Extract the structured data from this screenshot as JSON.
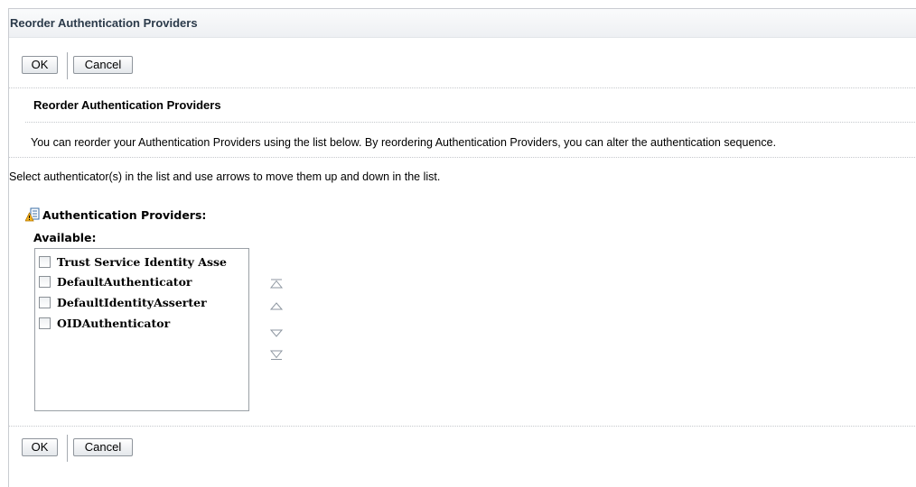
{
  "page": {
    "title": "Reorder Authentication Providers"
  },
  "toolbar_top": {
    "ok_label": "OK",
    "cancel_label": "Cancel"
  },
  "section": {
    "title": "Reorder Authentication Providers",
    "description": "You can reorder your Authentication Providers using the list below. By reordering Authentication Providers, you can alter the authentication sequence.",
    "instruction": "Select authenticator(s) in the list and use arrows to move them up and down in the list."
  },
  "providers": {
    "heading": "Authentication Providers:",
    "available_label": "Available:",
    "items": [
      {
        "label": "Trust Service Identity Asse",
        "checked": false
      },
      {
        "label": "DefaultAuthenticator",
        "checked": false
      },
      {
        "label": "DefaultIdentityAsserter",
        "checked": false
      },
      {
        "label": "OIDAuthenticator",
        "checked": false
      }
    ]
  },
  "arrows": [
    "move-to-top-icon",
    "move-up-icon",
    "move-down-icon",
    "move-to-bottom-icon"
  ],
  "toolbar_bottom": {
    "ok_label": "OK",
    "cancel_label": "Cancel"
  }
}
